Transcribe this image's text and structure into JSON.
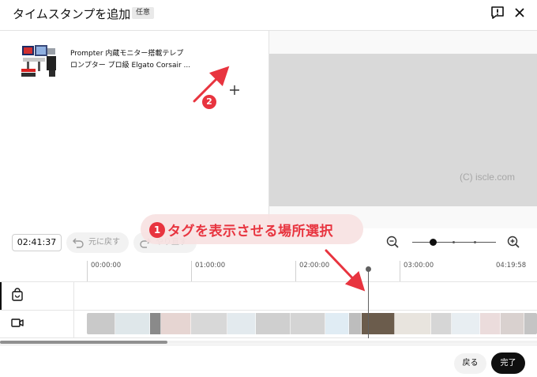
{
  "dialog": {
    "title": "タイムスタンプを追加",
    "badge": "任意",
    "feedback_icon": "feedback-icon",
    "close_icon": "close-icon"
  },
  "product": {
    "title_line1": "Prompter 内蔵モニター搭載テレプ",
    "title_line2": "ロンプター プロ級 Elgato Corsair ...",
    "add_icon": "plus-icon"
  },
  "preview": {
    "watermark": "(C) iscle.com"
  },
  "controls": {
    "time": "02:41:37",
    "undo_label": "元に戻す",
    "redo_label": "やり直す",
    "zoom_out_icon": "zoom-out-icon",
    "zoom_in_icon": "zoom-in-icon",
    "zoom_level": 0.25
  },
  "timeline": {
    "ticks": [
      "00:00:00",
      "01:00:00",
      "02:00:00",
      "03:00:00",
      "04:19:58"
    ],
    "tracks": [
      {
        "name": "shopping-track",
        "icon": "shopping-bag-icon"
      },
      {
        "name": "video-track",
        "icon": "video-camera-icon"
      }
    ],
    "playhead_time": "02:41:37"
  },
  "footer": {
    "back_label": "戻る",
    "done_label": "完了"
  },
  "annotations": {
    "step1_number": "1",
    "step1_text": "タグを表示させる場所選択",
    "step2_number": "2",
    "color": "#e8343f"
  }
}
